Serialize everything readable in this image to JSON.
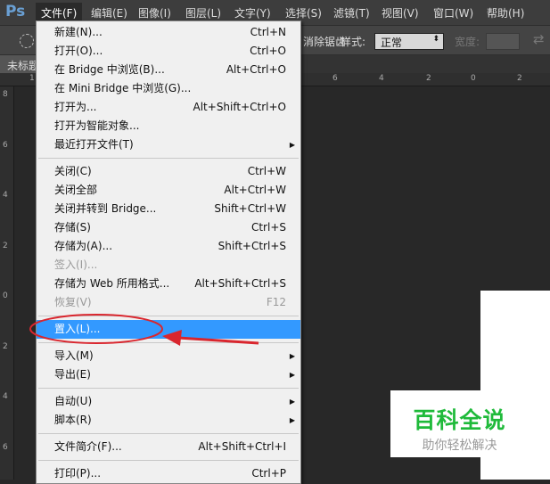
{
  "app": {
    "logo": "Ps"
  },
  "menubar": [
    "文件(F)",
    "编辑(E)",
    "图像(I)",
    "图层(L)",
    "文字(Y)",
    "选择(S)",
    "滤镜(T)",
    "视图(V)",
    "窗口(W)",
    "帮助(H)"
  ],
  "options": {
    "antialias": "消除锯齿",
    "style_label": "样式:",
    "style_value": "正常",
    "width_label": "宽度:"
  },
  "doc_tab": "未标题",
  "hruler": [
    "1",
    "6",
    "4",
    "2",
    "0",
    "2"
  ],
  "vruler": [
    "8",
    "6",
    "4",
    "2",
    "0",
    "2",
    "4",
    "6"
  ],
  "file_menu": [
    {
      "label": "新建(N)...",
      "shortcut": "Ctrl+N"
    },
    {
      "label": "打开(O)...",
      "shortcut": "Ctrl+O"
    },
    {
      "label": "在 Bridge 中浏览(B)...",
      "shortcut": "Alt+Ctrl+O"
    },
    {
      "label": "在 Mini Bridge 中浏览(G)...",
      "shortcut": ""
    },
    {
      "label": "打开为...",
      "shortcut": "Alt+Shift+Ctrl+O"
    },
    {
      "label": "打开为智能对象...",
      "shortcut": ""
    },
    {
      "label": "最近打开文件(T)",
      "shortcut": "",
      "submenu": true
    },
    {
      "sep": true
    },
    {
      "label": "关闭(C)",
      "shortcut": "Ctrl+W"
    },
    {
      "label": "关闭全部",
      "shortcut": "Alt+Ctrl+W"
    },
    {
      "label": "关闭并转到 Bridge...",
      "shortcut": "Shift+Ctrl+W"
    },
    {
      "label": "存储(S)",
      "shortcut": "Ctrl+S"
    },
    {
      "label": "存储为(A)...",
      "shortcut": "Shift+Ctrl+S"
    },
    {
      "label": "签入(I)...",
      "shortcut": "",
      "disabled": true
    },
    {
      "label": "存储为 Web 所用格式...",
      "shortcut": "Alt+Shift+Ctrl+S"
    },
    {
      "label": "恢复(V)",
      "shortcut": "F12",
      "disabled": true
    },
    {
      "sep": true
    },
    {
      "label": "置入(L)...",
      "shortcut": "",
      "highlighted": true
    },
    {
      "sep": true
    },
    {
      "label": "导入(M)",
      "shortcut": "",
      "submenu": true
    },
    {
      "label": "导出(E)",
      "shortcut": "",
      "submenu": true
    },
    {
      "sep": true
    },
    {
      "label": "自动(U)",
      "shortcut": "",
      "submenu": true
    },
    {
      "label": "脚本(R)",
      "shortcut": "",
      "submenu": true
    },
    {
      "sep": true
    },
    {
      "label": "文件简介(F)...",
      "shortcut": "Alt+Shift+Ctrl+I"
    },
    {
      "sep": true
    },
    {
      "label": "打印(P)...",
      "shortcut": "Ctrl+P"
    }
  ],
  "watermark": {
    "title": "百科全说",
    "subtitle": "助你轻松解决"
  },
  "colors": {
    "highlight": "#3399ff",
    "annotation": "#d9262e",
    "watermark": "#1fba3a"
  }
}
